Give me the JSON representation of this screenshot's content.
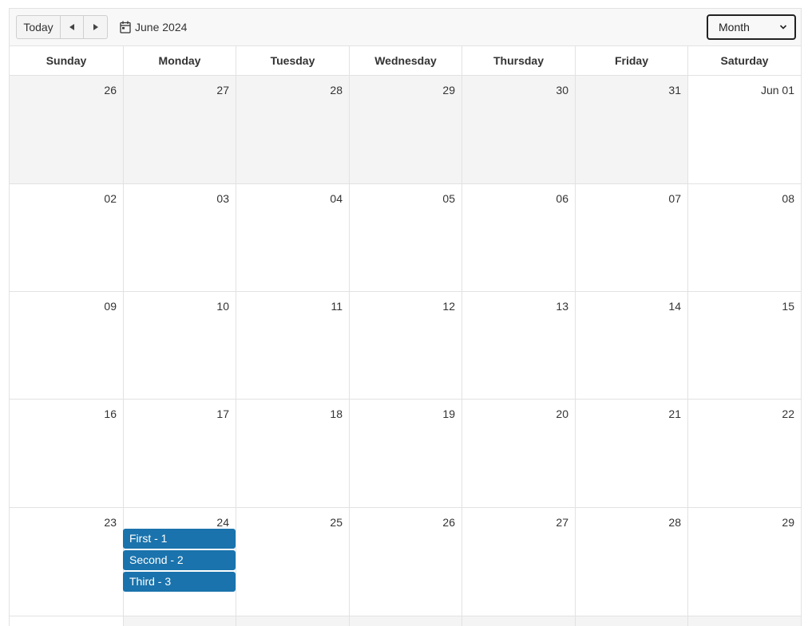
{
  "toolbar": {
    "today_label": "Today",
    "prev_icon": "caret-left-icon",
    "next_icon": "caret-right-icon",
    "calendar_icon": "calendar-icon",
    "current_period": "June 2024",
    "view_selected": "Month",
    "view_options": [
      "Month"
    ]
  },
  "weekdays": [
    "Sunday",
    "Monday",
    "Tuesday",
    "Wednesday",
    "Thursday",
    "Friday",
    "Saturday"
  ],
  "weeks": [
    {
      "days": [
        {
          "label": "26",
          "other_month": true
        },
        {
          "label": "27",
          "other_month": true
        },
        {
          "label": "28",
          "other_month": true
        },
        {
          "label": "29",
          "other_month": true
        },
        {
          "label": "30",
          "other_month": true
        },
        {
          "label": "31",
          "other_month": true
        },
        {
          "label": "Jun 01",
          "other_month": false
        }
      ]
    },
    {
      "days": [
        {
          "label": "02"
        },
        {
          "label": "03"
        },
        {
          "label": "04"
        },
        {
          "label": "05"
        },
        {
          "label": "06"
        },
        {
          "label": "07"
        },
        {
          "label": "08"
        }
      ]
    },
    {
      "days": [
        {
          "label": "09"
        },
        {
          "label": "10"
        },
        {
          "label": "11"
        },
        {
          "label": "12"
        },
        {
          "label": "13"
        },
        {
          "label": "14"
        },
        {
          "label": "15"
        }
      ]
    },
    {
      "days": [
        {
          "label": "16"
        },
        {
          "label": "17"
        },
        {
          "label": "18"
        },
        {
          "label": "19"
        },
        {
          "label": "20"
        },
        {
          "label": "21"
        },
        {
          "label": "22"
        }
      ]
    },
    {
      "days": [
        {
          "label": "23"
        },
        {
          "label": "24",
          "events": [
            "First - 1",
            "Second - 2",
            "Third - 3"
          ]
        },
        {
          "label": "25"
        },
        {
          "label": "26"
        },
        {
          "label": "27"
        },
        {
          "label": "28"
        },
        {
          "label": "29"
        }
      ]
    }
  ],
  "colors": {
    "event": "#1a73ac",
    "other_month_bg": "#f4f4f4",
    "border": "#e2e2e2"
  }
}
